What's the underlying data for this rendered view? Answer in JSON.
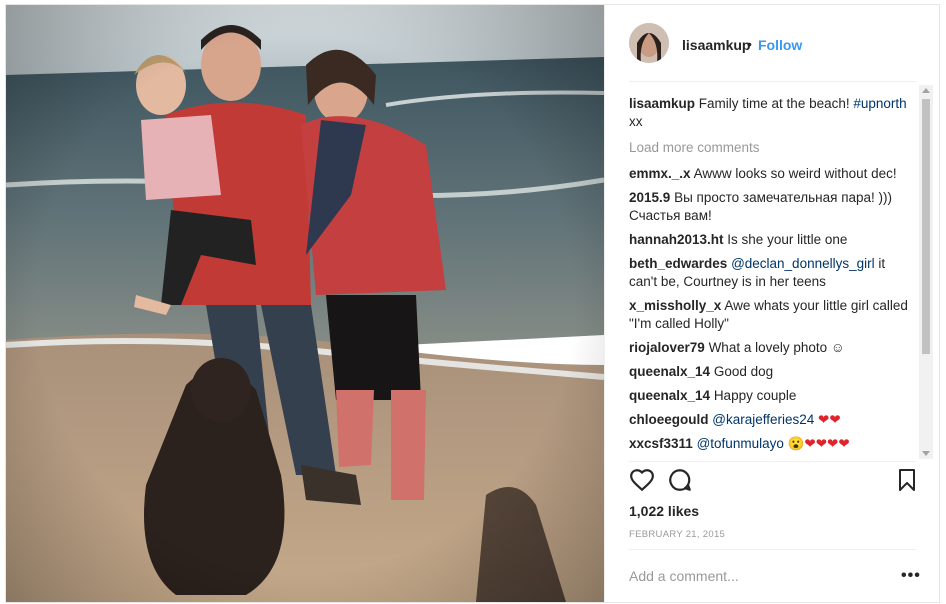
{
  "post": {
    "username": "lisaamkup",
    "separator": "•",
    "follow_label": "Follow",
    "caption_user": "lisaamkup",
    "caption_text": "Family time at the beach!",
    "caption_hashtag": "#upnorth",
    "caption_tail": " xx",
    "load_more": "Load more comments",
    "comments": [
      {
        "user": "emmx._.x",
        "text": "Awww looks so weird without dec!"
      },
      {
        "user": "2015.9",
        "text": "Вы просто замечательная пара! ))) Счастья вам!"
      },
      {
        "user": "hannah2013.ht",
        "text": "Is she your little one"
      },
      {
        "user": "beth_edwardes",
        "mention": "@declan_donnellys_girl",
        "text": " it can't be, Courtney is in her teens"
      },
      {
        "user": "x_missholly_x",
        "text": "Awe whats your little girl called \"I'm called Holly\""
      },
      {
        "user": "riojalover79",
        "text": "What a lovely photo ☺"
      },
      {
        "user": "queenalx_14",
        "text": "Good dog"
      },
      {
        "user": "queenalx_14",
        "text": "Happy couple"
      },
      {
        "user": "chloeegould",
        "mention": "@karajefferies24",
        "text": " ❤❤"
      },
      {
        "user": "xxcsf3311",
        "mention": "@tofunmulayo",
        "text": " 😮❤❤❤❤"
      }
    ],
    "likes": "1,022 likes",
    "date": "FEBRUARY 21, 2015",
    "add_comment_placeholder": "Add a comment...",
    "more_label": "•••"
  },
  "icons": [
    "heart-icon",
    "comment-icon",
    "bookmark-icon",
    "more-options-icon"
  ],
  "colors": {
    "follow": "#3897f0",
    "link": "#003569",
    "muted": "#999999",
    "heart": "#e0222a"
  }
}
